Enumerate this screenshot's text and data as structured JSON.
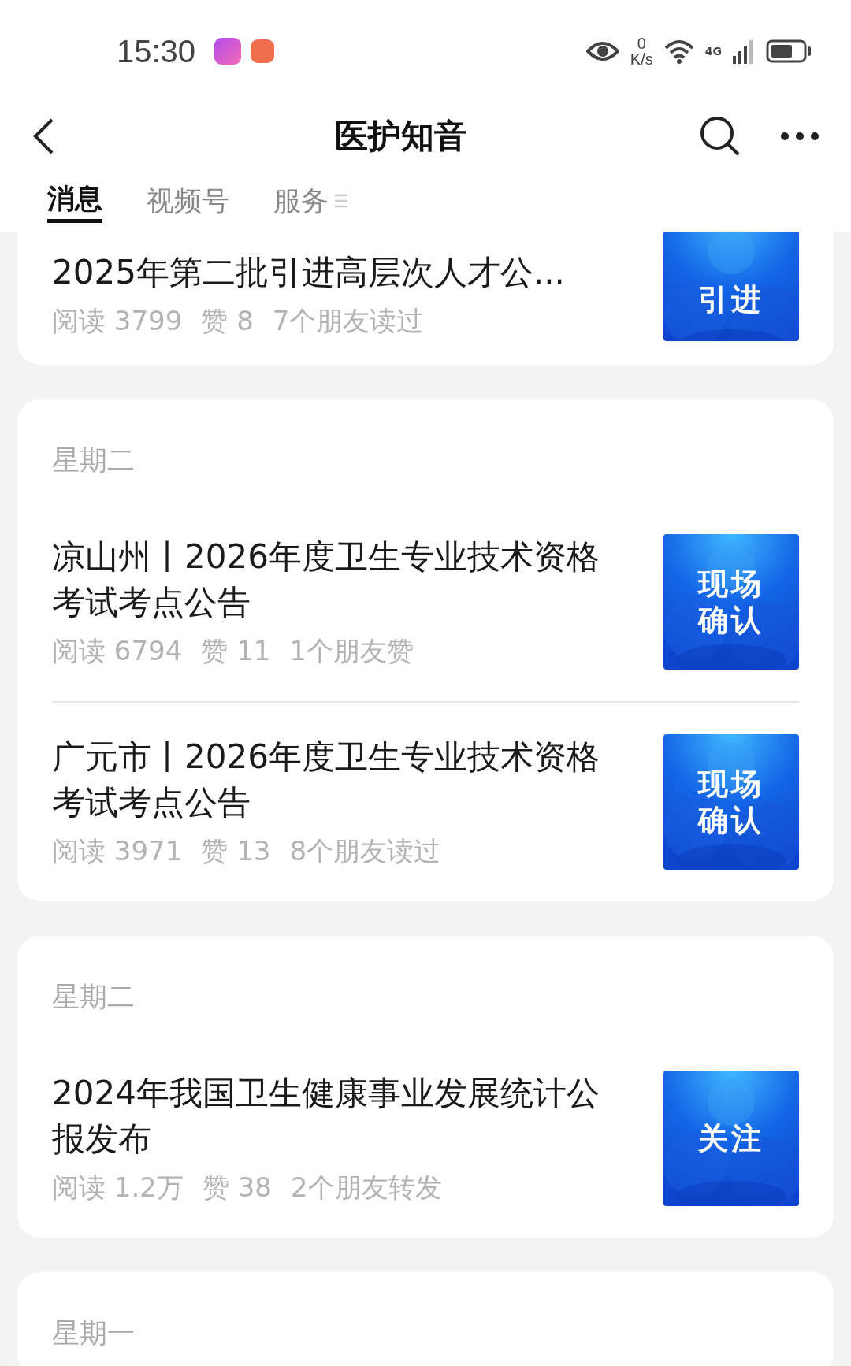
{
  "status_bar": {
    "time": "15:30",
    "net_speed_value": "0",
    "net_speed_unit": "K/s",
    "network": "4G"
  },
  "nav": {
    "title": "医护知音"
  },
  "tabs": [
    {
      "label": "消息",
      "selected": true
    },
    {
      "label": "视频号",
      "selected": false
    },
    {
      "label": "服务",
      "selected": false
    }
  ],
  "groups": [
    {
      "articles": [
        {
          "title": "2025年第二批引进高层次人才公...",
          "meta": [
            "阅读 3799",
            "赞 8",
            "7个朋友读过"
          ],
          "thumb": [
            "引进"
          ]
        }
      ]
    },
    {
      "day": "星期二",
      "articles": [
        {
          "title": "凉山州丨2026年度卫生专业技术资格考试考点公告",
          "meta": [
            "阅读 6794",
            "赞 11",
            "1个朋友赞"
          ],
          "thumb": [
            "现场",
            "确认"
          ]
        },
        {
          "title": "广元市丨2026年度卫生专业技术资格考试考点公告",
          "meta": [
            "阅读 3971",
            "赞 13",
            "8个朋友读过"
          ],
          "thumb": [
            "现场",
            "确认"
          ]
        }
      ]
    },
    {
      "day": "星期二",
      "articles": [
        {
          "title": "2024年我国卫生健康事业发展统计公报发布",
          "meta": [
            "阅读 1.2万",
            "赞 38",
            "2个朋友转发"
          ],
          "thumb": [
            "关注"
          ]
        }
      ]
    },
    {
      "day": "星期一"
    }
  ]
}
